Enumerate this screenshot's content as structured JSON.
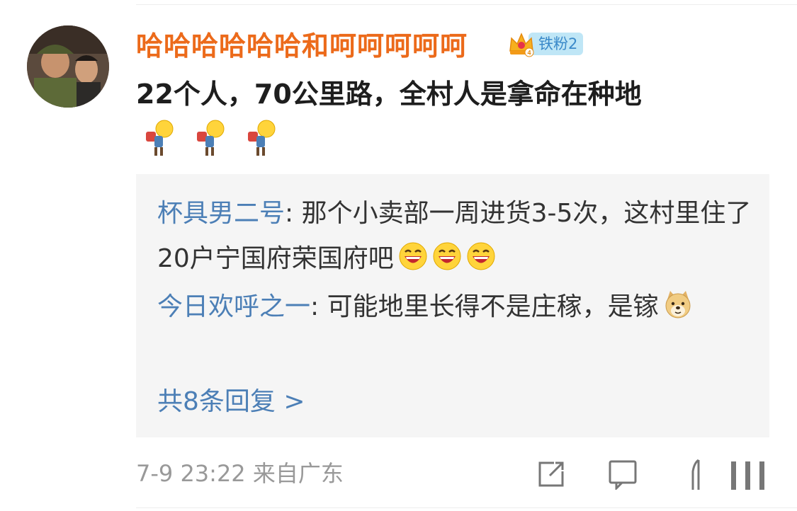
{
  "comment": {
    "username": "哈哈哈哈哈哈和呵呵呵呵呵",
    "badge": {
      "level": "4",
      "label": "铁粉2",
      "icon": "crown-icon"
    },
    "text": "22个人，70公里路，全村人是拿命在种地",
    "emojis": [
      "carry-back-emoji-icon",
      "carry-back-emoji-icon",
      "carry-back-emoji-icon"
    ]
  },
  "replies": [
    {
      "author": "杯具男二号",
      "separator": ": ",
      "text": "那个小卖部一周进货3-5次，这村里住了20户宁国府荣国府吧",
      "emojis": [
        "laughing-emoji-icon",
        "laughing-emoji-icon",
        "laughing-emoji-icon"
      ]
    },
    {
      "author": "今日欢呼之一",
      "separator": ": ",
      "text": "可能地里长得不是庄稼，是镓",
      "emojis": [
        "doge-emoji-icon"
      ]
    }
  ],
  "more_replies": "共8条回复 >",
  "footer": {
    "time": "7-9 23:22",
    "source": "来自广东",
    "actions": [
      "share-icon",
      "comment-icon",
      "like-icon",
      "more-icon"
    ]
  },
  "colors": {
    "username": "#ec6a1a",
    "reply_author": "#4c7fb6",
    "badge_bg": "#bfe6f6",
    "reply_bg": "#f5f5f5"
  }
}
